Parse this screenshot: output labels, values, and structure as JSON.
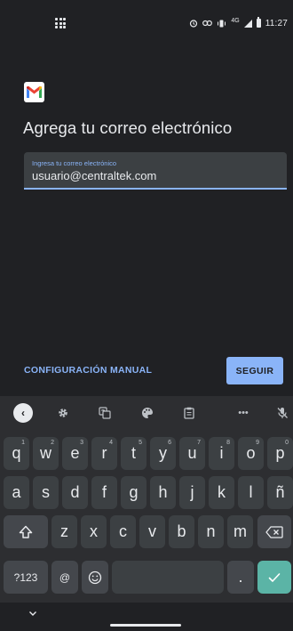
{
  "status_bar": {
    "time": "11:27",
    "network": "4G",
    "icons": [
      "apps-grid-icon",
      "alarm-icon",
      "link-icon",
      "vibrate-icon",
      "signal-icon",
      "battery-icon"
    ]
  },
  "brand": {
    "logo": "gmail-logo",
    "colors": {
      "red": "#ea4335",
      "blue": "#4285f4",
      "green": "#34a853",
      "yellow": "#fbbc04"
    }
  },
  "title": "Agrega tu correo electrónico",
  "email_field": {
    "label": "Ingresa tu correo electrónico",
    "value": "usuario@centraltek.com"
  },
  "actions": {
    "manual": "CONFIGURACIÓN MANUAL",
    "next": "SEGUIR"
  },
  "keyboard": {
    "toolbar": [
      "collapse-icon",
      "settings-icon",
      "translate-icon",
      "palette-icon",
      "clipboard-icon",
      "more-icon",
      "mic-off-icon"
    ],
    "row1": [
      {
        "k": "q",
        "s": "1"
      },
      {
        "k": "w",
        "s": "2"
      },
      {
        "k": "e",
        "s": "3"
      },
      {
        "k": "r",
        "s": "4"
      },
      {
        "k": "t",
        "s": "5"
      },
      {
        "k": "y",
        "s": "6"
      },
      {
        "k": "u",
        "s": "7"
      },
      {
        "k": "i",
        "s": "8"
      },
      {
        "k": "o",
        "s": "9"
      },
      {
        "k": "p",
        "s": "0"
      }
    ],
    "row2": [
      "a",
      "s",
      "d",
      "f",
      "g",
      "h",
      "j",
      "k",
      "l",
      "ñ"
    ],
    "row3": [
      "z",
      "x",
      "c",
      "v",
      "b",
      "n",
      "m"
    ],
    "symbols": "?123",
    "at": "@",
    "period": "."
  },
  "accent": "#8ab4f8"
}
